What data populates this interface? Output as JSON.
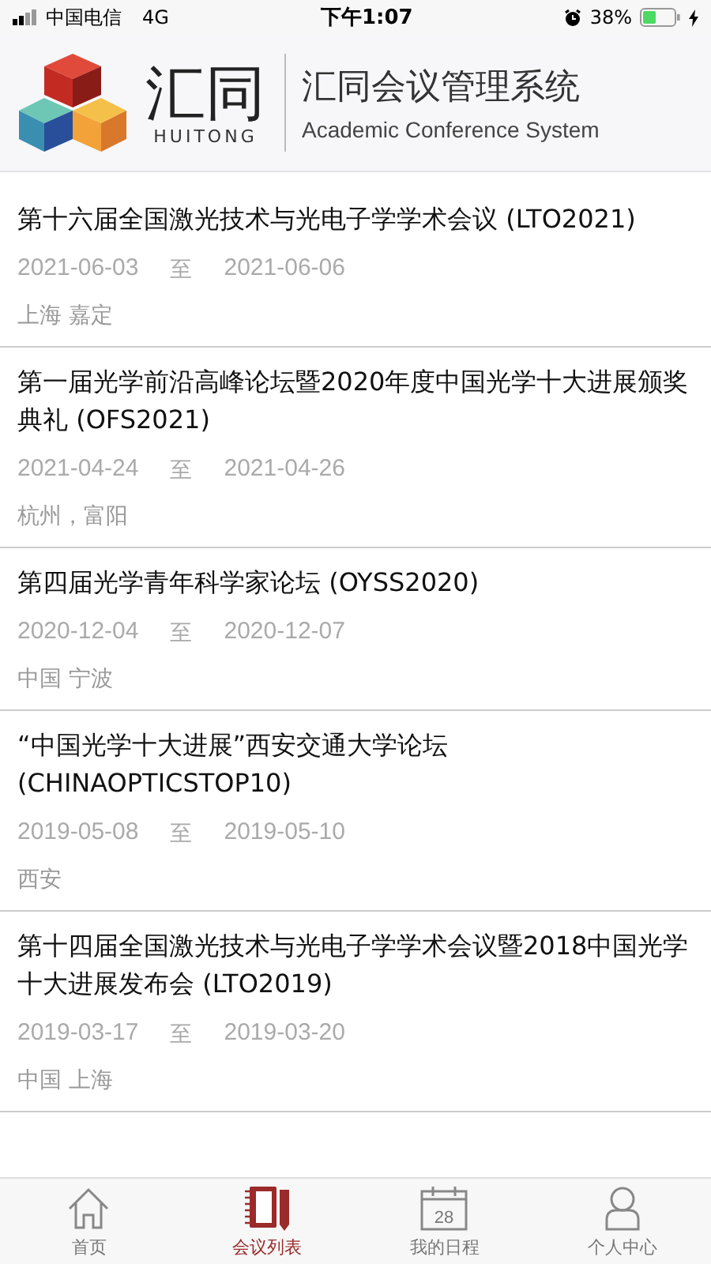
{
  "status_bar": {
    "carrier": "中国电信",
    "network": "4G",
    "time": "下午1:07",
    "battery": "38%"
  },
  "header": {
    "logo_text": "汇同",
    "logo_sub": "HUITONG",
    "title": "汇同会议管理系统",
    "subtitle": "Academic Conference System"
  },
  "conferences": [
    {
      "title": "第十六届全国激光技术与光电子学学术会议 (LTO2021)",
      "start": "2021-06-03",
      "to": "至",
      "end": "2021-06-06",
      "location": "上海 嘉定"
    },
    {
      "title": "第一届光学前沿高峰论坛暨2020年度中国光学十大进展颁奖典礼 (OFS2021)",
      "start": "2021-04-24",
      "to": "至",
      "end": "2021-04-26",
      "location": "杭州，富阳"
    },
    {
      "title": "第四届光学青年科学家论坛 (OYSS2020)",
      "start": "2020-12-04",
      "to": "至",
      "end": "2020-12-07",
      "location": "中国 宁波"
    },
    {
      "title": "“中国光学十大进展”西安交通大学论坛 (CHINAOPTICSTOP10)",
      "start": "2019-05-08",
      "to": "至",
      "end": "2019-05-10",
      "location": "西安"
    },
    {
      "title": "第十四届全国激光技术与光电子学学术会议暨2018中国光学十大进展发布会 (LTO2019)",
      "start": "2019-03-17",
      "to": "至",
      "end": "2019-03-20",
      "location": "中国 上海"
    }
  ],
  "tabs": [
    {
      "label": "首页",
      "kind": "home",
      "selected": false
    },
    {
      "label": "会议列表",
      "kind": "notebook",
      "selected": true
    },
    {
      "label": "我的日程",
      "kind": "calendar",
      "icon_text": "28",
      "selected": false
    },
    {
      "label": "个人中心",
      "kind": "person",
      "selected": false
    }
  ]
}
